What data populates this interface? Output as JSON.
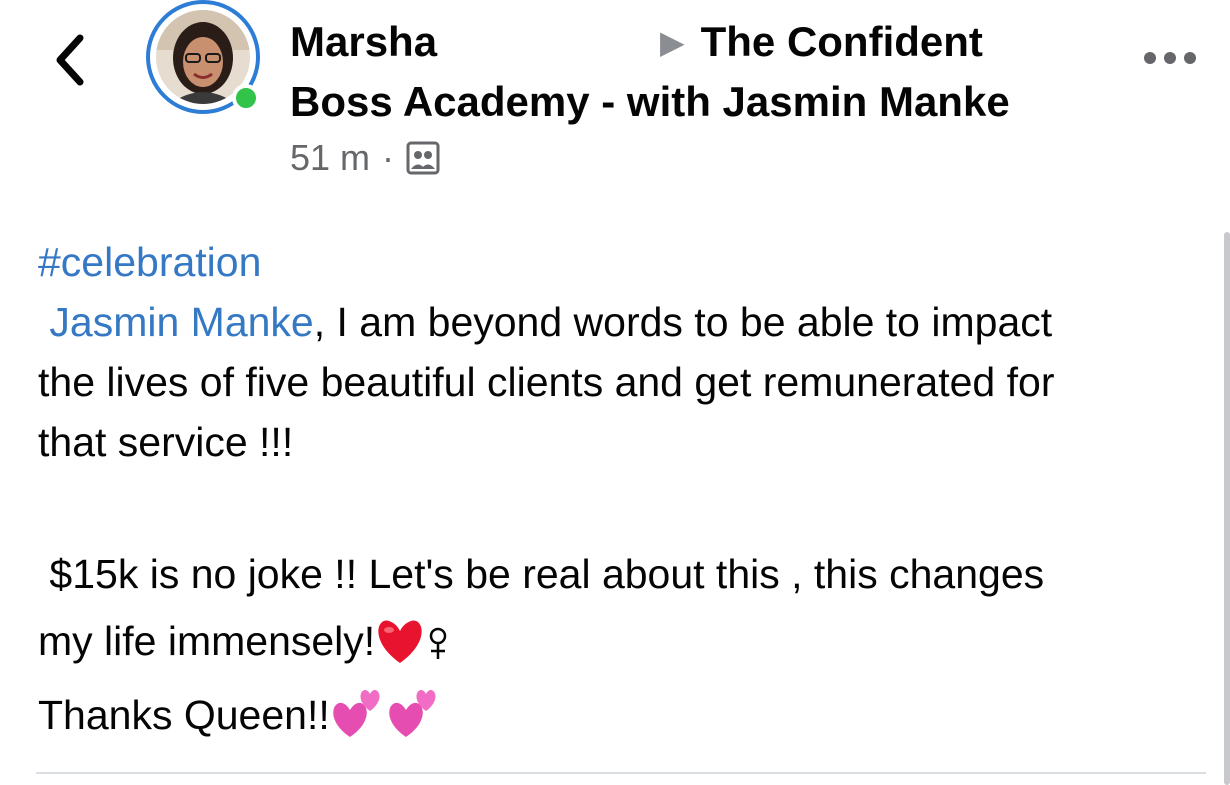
{
  "header": {
    "author_name": "Marsha",
    "group_title": "The Confident Boss Academy - with Jasmin Manke",
    "group_title_line1": "The Confident",
    "group_title_line2": "Boss Academy - with Jasmin Manke",
    "time_ago": "51 m",
    "separator": "·"
  },
  "post": {
    "hashtag": "#celebration",
    "mention": "Jasmin Manke",
    "line1_rest": ", I am beyond words to be able to impact",
    "line2": "the lives of five beautiful clients and get remunerated for",
    "line3": "that service !!!",
    "line4": "$15k is no joke !! Let's be real about this , this changes",
    "line5": "my life immensely!",
    "line6": "Thanks Queen!!"
  },
  "colors": {
    "link": "#3578c4",
    "online": "#31c34a",
    "ring": "#2d7dd6"
  },
  "icons": [
    "back-chevron-icon",
    "online-status-icon",
    "group-audience-icon",
    "more-options-icon",
    "red-heart-emoji",
    "woman-symbol-icon",
    "two-hearts-emoji"
  ]
}
